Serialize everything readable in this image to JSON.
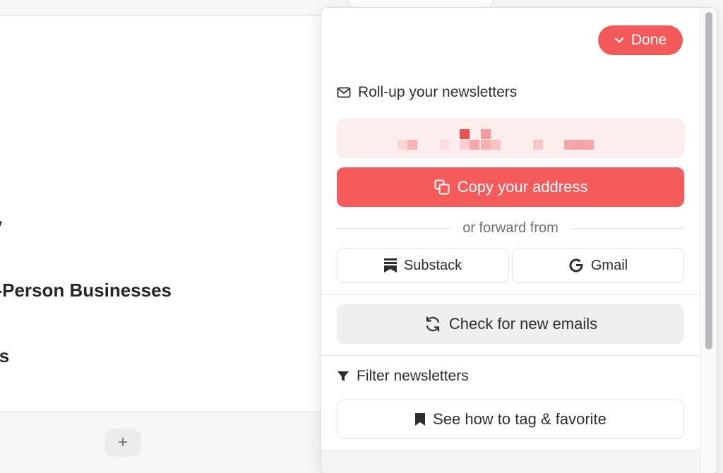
{
  "background": {
    "lines": [
      {
        "text": "ty"
      },
      {
        "text": "e-Person Businesses"
      },
      {
        "text": "rts"
      }
    ],
    "add_label": "+"
  },
  "popover": {
    "done_label": "Done",
    "rollup": {
      "title": "Roll-up your newsletters",
      "icon": "mail-icon"
    },
    "copy_label": "Copy your address",
    "forward_label": "or forward from",
    "sources": [
      {
        "label": "Substack",
        "icon": "substack-icon"
      },
      {
        "label": "Gmail",
        "icon": "google-icon"
      }
    ],
    "check_label": "Check for new emails",
    "filter": {
      "title": "Filter newsletters",
      "icon": "filter-icon"
    },
    "tag_label": "See how to tag & favorite"
  },
  "colors": {
    "accent": "#f65b5b",
    "address_bg": "#fdeeee",
    "neutral_button": "#efeff1"
  }
}
